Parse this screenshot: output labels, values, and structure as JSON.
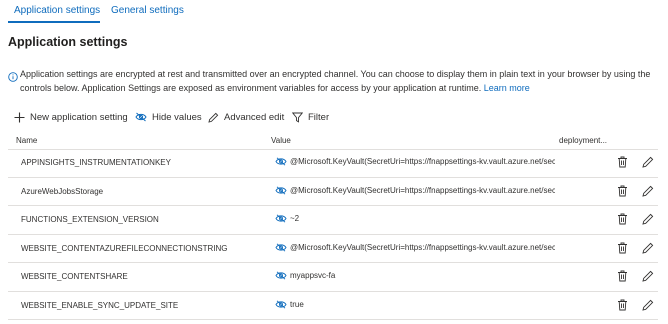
{
  "tabs": {
    "app_settings": "Application settings",
    "general_settings": "General settings"
  },
  "page_title": "Application settings",
  "info": {
    "text": "Application settings are encrypted at rest and transmitted over an encrypted channel. You can choose to display them in plain text in your browser by using the controls below. Application Settings are exposed as environment variables for access by your application at runtime.",
    "link": "Learn more"
  },
  "toolbar": {
    "new_setting": "New application setting",
    "hide_values": "Hide values",
    "advanced_edit": "Advanced edit",
    "filter": "Filter"
  },
  "columns": {
    "name": "Name",
    "value": "Value",
    "deployment": "deployment..."
  },
  "rows": [
    {
      "name": "APPINSIGHTS_INSTRUMENTATIONKEY",
      "value": "@Microsoft.KeyVault(SecretUri=https://fnappsettings-kv.vault.azure.net/secr"
    },
    {
      "name": "AzureWebJobsStorage",
      "value": "@Microsoft.KeyVault(SecretUri=https://fnappsettings-kv.vault.azure.net/secr"
    },
    {
      "name": "FUNCTIONS_EXTENSION_VERSION",
      "value": "~2"
    },
    {
      "name": "WEBSITE_CONTENTAZUREFILECONNECTIONSTRING",
      "value": "@Microsoft.KeyVault(SecretUri=https://fnappsettings-kv.vault.azure.net/secr"
    },
    {
      "name": "WEBSITE_CONTENTSHARE",
      "value": "myappsvc-fa"
    },
    {
      "name": "WEBSITE_ENABLE_SYNC_UPDATE_SITE",
      "value": "true"
    }
  ],
  "icons": {
    "plus": "plus-icon",
    "hide": "eye-off-icon",
    "edit": "pencil-icon",
    "filter": "filter-icon",
    "visibility": "eye-icon",
    "delete": "trash-icon",
    "info": "info-icon"
  },
  "colors": {
    "accent": "#0f6cbd",
    "text": "#323130"
  }
}
